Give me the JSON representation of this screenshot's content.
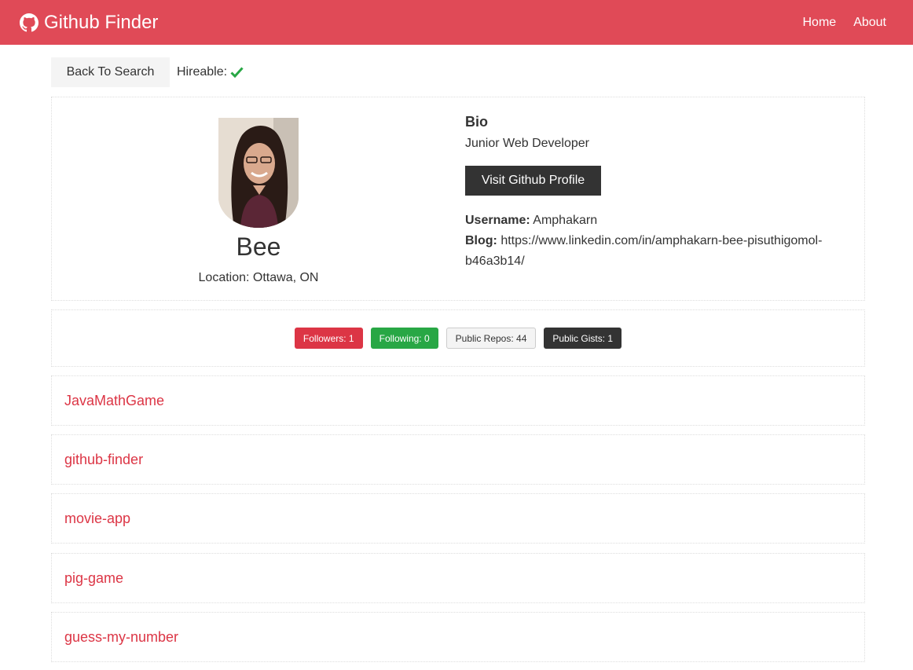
{
  "navbar": {
    "brand_icon": "github-icon",
    "title": "Github Finder",
    "links": [
      "Home",
      "About"
    ]
  },
  "toolbar": {
    "back_label": "Back To Search",
    "hireable_label": "Hireable:",
    "hireable_icon": "check-icon"
  },
  "profile": {
    "name": "Bee",
    "location": "Location: Ottawa, ON",
    "bio_heading": "Bio",
    "bio": "Junior Web Developer",
    "visit_label": "Visit Github Profile",
    "username_label": "Username:",
    "username": "Amphakarn",
    "blog_label": "Blog:",
    "blog": "https://www.linkedin.com/in/amphakarn-bee-pisuthigomol-b46a3b14/"
  },
  "stats": [
    {
      "label": "Followers: 1",
      "color": "#dc3545"
    },
    {
      "label": "Following: 0",
      "color": "#28a745"
    },
    {
      "label": "Public Repos: 44",
      "color": "#f4f4f4"
    },
    {
      "label": "Public Gists: 1",
      "color": "#333333"
    }
  ],
  "repos": [
    "JavaMathGame",
    "github-finder",
    "movie-app",
    "pig-game",
    "guess-my-number"
  ],
  "colors": {
    "primary": "#dc3545",
    "success": "#28a745",
    "dark": "#333333",
    "light": "#f4f4f4"
  }
}
